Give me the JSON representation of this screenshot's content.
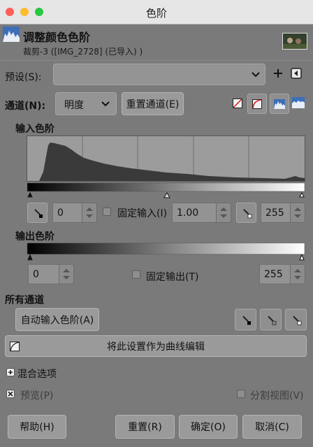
{
  "window": {
    "title": "色阶"
  },
  "header": {
    "heading": "调整颜色色阶",
    "subtitle": "裁剪-3 ([IMG_2728] (已导入) )"
  },
  "presets": {
    "label": "预设(S):",
    "value": ""
  },
  "channel": {
    "label": "通道(N):",
    "value": "明度",
    "reset_label": "重置通道(E)"
  },
  "input_levels": {
    "heading": "输入色阶",
    "black_value": "0",
    "gamma_value": "1.00",
    "white_value": "255",
    "clamp_label": "固定输入(I)"
  },
  "output_levels": {
    "heading": "输出色阶",
    "black_value": "0",
    "white_value": "255",
    "clamp_label": "固定输出(T)"
  },
  "all_channels": {
    "heading": "所有通道",
    "auto_label": "自动输入色阶(A)"
  },
  "curves_button": {
    "label": "将此设置作为曲线编辑"
  },
  "blend": {
    "label": "混合选项"
  },
  "preview": {
    "label": "预览(P)",
    "checked": true
  },
  "split_view": {
    "label": "分割视图(V)",
    "checked": false
  },
  "footer": {
    "help": "帮助(H)",
    "reset": "重置(R)",
    "ok": "确定(O)",
    "cancel": "取消(C)"
  },
  "colors": {
    "background": "#7a7a7a",
    "histogram": "#3a3a3a",
    "red_dot": "#ff5f57",
    "yellow_dot": "#febc2e",
    "green_dot": "#28c840"
  }
}
